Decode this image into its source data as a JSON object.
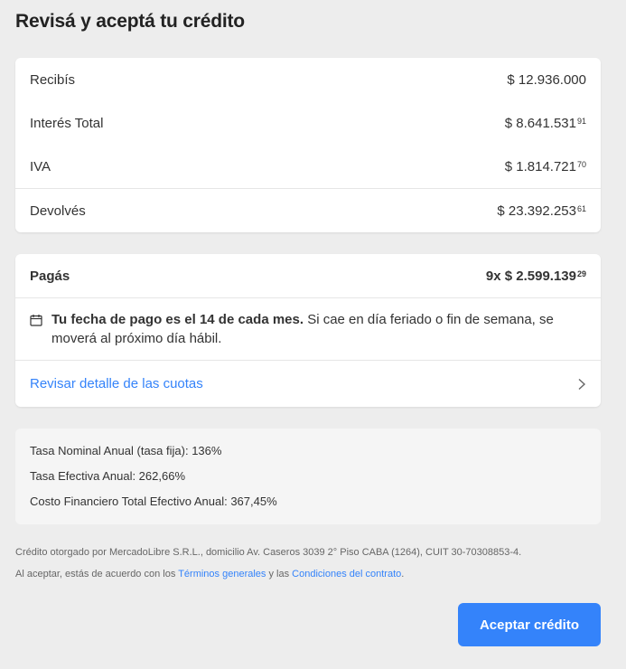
{
  "page": {
    "title": "Revisá y aceptá tu crédito"
  },
  "summary": {
    "rows": [
      {
        "label": "Recibís",
        "amount": "$ 12.936.000",
        "cents": ""
      },
      {
        "label": "Interés Total",
        "amount": "$ 8.641.531",
        "cents": "91"
      },
      {
        "label": "IVA",
        "amount": "$ 1.814.721",
        "cents": "70"
      },
      {
        "label": "Devolvés",
        "amount": "$ 23.392.253",
        "cents": "61"
      }
    ]
  },
  "payment": {
    "label": "Pagás",
    "amount": "9x $ 2.599.139",
    "cents": "29",
    "date_bold_prefix": "Tu fecha de pago es el",
    "date_day": "14",
    "date_bold_suffix": "de cada mes.",
    "date_note": "Si cae en día feriado o fin de semana, se moverá al próximo día hábil.",
    "detail_link": "Revisar detalle de las cuotas",
    "icons": {
      "calendar": "calendar-icon",
      "chevron": "chevron-right-icon"
    }
  },
  "rates": {
    "tna": "Tasa Nominal Anual (tasa fija): 136%",
    "tea": "Tasa Efectiva Anual: 262,66%",
    "cftea": "Costo Financiero Total Efectivo Anual: 367,45%"
  },
  "legal": {
    "lender": "Crédito otorgado por MercadoLibre S.R.L., domicilio Av. Caseros 3039 2° Piso CABA (1264), CUIT 30-70308853-4.",
    "accept_prefix": "Al aceptar, estás de acuerdo con los",
    "terms_link": "Términos generales",
    "and": "y las",
    "conditions_link": "Condiciones del contrato",
    "end": "."
  },
  "actions": {
    "accept_label": "Aceptar crédito"
  },
  "colors": {
    "accent": "#3483fa",
    "background": "#ededed",
    "card": "#ffffff"
  }
}
